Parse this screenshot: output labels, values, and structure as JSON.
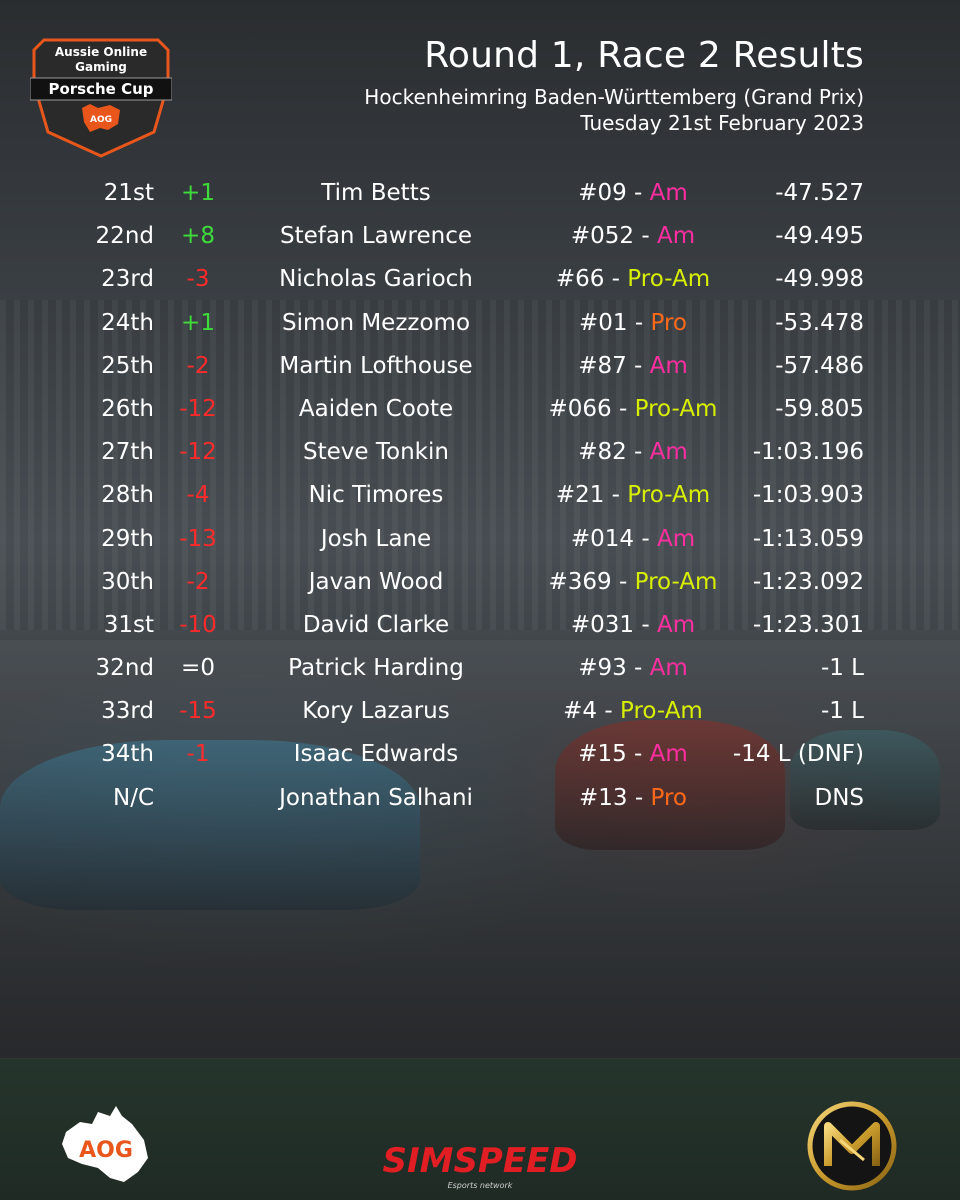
{
  "header": {
    "title": "Round 1, Race 2 Results",
    "track": "Hockenheimring Baden-Württemberg (Grand Prix)",
    "date": "Tuesday 21st February 2023"
  },
  "cup_logo": {
    "line1": "Aussie Online",
    "line2": "Gaming",
    "line3": "Porsche Cup",
    "badge": "AOG"
  },
  "results": [
    {
      "pos": "21st",
      "change": "+1",
      "change_type": "up",
      "name": "Tim Betts",
      "car_num": "#09 - ",
      "class": "Am",
      "class_type": "am",
      "gap": "-47.527"
    },
    {
      "pos": "22nd",
      "change": "+8",
      "change_type": "up",
      "name": "Stefan Lawrence",
      "car_num": "#052 - ",
      "class": "Am",
      "class_type": "am",
      "gap": "-49.495"
    },
    {
      "pos": "23rd",
      "change": "-3",
      "change_type": "down",
      "name": "Nicholas Garioch",
      "car_num": "#66 - ",
      "class": "Pro-Am",
      "class_type": "proam",
      "gap": "-49.998"
    },
    {
      "pos": "24th",
      "change": "+1",
      "change_type": "up",
      "name": "Simon Mezzomo",
      "car_num": "#01 - ",
      "class": "Pro",
      "class_type": "pro",
      "gap": "-53.478"
    },
    {
      "pos": "25th",
      "change": "-2",
      "change_type": "down",
      "name": "Martin Lofthouse",
      "car_num": "#87 - ",
      "class": "Am",
      "class_type": "am",
      "gap": "-57.486"
    },
    {
      "pos": "26th",
      "change": "-12",
      "change_type": "down",
      "name": "Aaiden Coote",
      "car_num": "#066 - ",
      "class": "Pro-Am",
      "class_type": "proam",
      "gap": "-59.805"
    },
    {
      "pos": "27th",
      "change": "-12",
      "change_type": "down",
      "name": "Steve Tonkin",
      "car_num": "#82 - ",
      "class": "Am",
      "class_type": "am",
      "gap": "-1:03.196"
    },
    {
      "pos": "28th",
      "change": "-4",
      "change_type": "down",
      "name": "Nic Timores",
      "car_num": "#21 - ",
      "class": "Pro-Am",
      "class_type": "proam",
      "gap": "-1:03.903"
    },
    {
      "pos": "29th",
      "change": "-13",
      "change_type": "down",
      "name": "Josh Lane",
      "car_num": "#014 - ",
      "class": "Am",
      "class_type": "am",
      "gap": "-1:13.059"
    },
    {
      "pos": "30th",
      "change": "-2",
      "change_type": "down",
      "name": "Javan Wood",
      "car_num": "#369 - ",
      "class": "Pro-Am",
      "class_type": "proam",
      "gap": "-1:23.092"
    },
    {
      "pos": "31st",
      "change": "-10",
      "change_type": "down",
      "name": "David Clarke",
      "car_num": "#031 - ",
      "class": "Am",
      "class_type": "am",
      "gap": "-1:23.301"
    },
    {
      "pos": "32nd",
      "change": "=0",
      "change_type": "same",
      "name": "Patrick Harding",
      "car_num": "#93 - ",
      "class": "Am",
      "class_type": "am",
      "gap": "-1 L"
    },
    {
      "pos": "33rd",
      "change": "-15",
      "change_type": "down",
      "name": "Kory Lazarus",
      "car_num": "#4 - ",
      "class": "Pro-Am",
      "class_type": "proam",
      "gap": "-1 L"
    },
    {
      "pos": "34th",
      "change": "-1",
      "change_type": "down",
      "name": "Isaac Edwards",
      "car_num": "#15 - ",
      "class": "Am",
      "class_type": "am",
      "gap": "-14 L (DNF)"
    },
    {
      "pos": "N/C",
      "change": "",
      "change_type": "same",
      "name": "Jonathan Salhani",
      "car_num": "#13 - ",
      "class": "Pro",
      "class_type": "pro",
      "gap": "DNS"
    }
  ],
  "footer": {
    "aog_logo_text": "AOG",
    "simspeed_text": "SIMSPEED",
    "simspeed_tagline": "Esports network"
  },
  "colors": {
    "up": "#3ddc3a",
    "down": "#ff2a2a",
    "am": "#ff2ea0",
    "proam": "#d8f000",
    "pro": "#ff6a1a",
    "logo_orange": "#e8561c"
  }
}
